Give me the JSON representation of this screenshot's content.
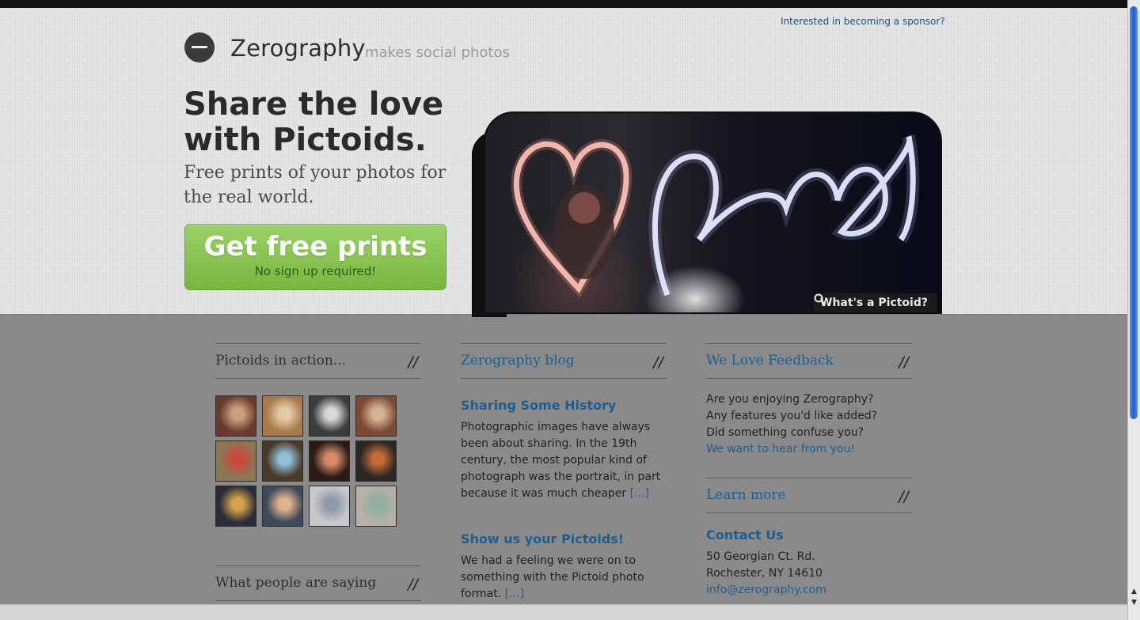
{
  "header": {
    "sponsor_link": "Interested in becoming a sponsor?",
    "brand": "Zerography",
    "tagline": "makes social photos"
  },
  "hero": {
    "headline": "Share the love with Pictoids.",
    "subheadline": "Free prints of your photos for the real world.",
    "cta_title": "Get free prints",
    "cta_subtitle": "No sign up required!",
    "photo_badge": "What's a Pictoid?"
  },
  "columns": {
    "pictoids": {
      "title": "Pictoids in action...",
      "slashes": "//",
      "thumbnails": [
        {
          "color": "#6b3a2f",
          "accent": "#c9a27a"
        },
        {
          "color": "#a8794c",
          "accent": "#e4c9a3"
        },
        {
          "color": "#3a3c3d",
          "accent": "#d8d8d8"
        },
        {
          "color": "#7a4a34",
          "accent": "#d6b391"
        },
        {
          "color": "#8b7656",
          "accent": "#c94a3a"
        },
        {
          "color": "#4a3a2a",
          "accent": "#8fc0d8"
        },
        {
          "color": "#2a1a18",
          "accent": "#d88a6a"
        },
        {
          "color": "#2c2624",
          "accent": "#c46a3a"
        },
        {
          "color": "#2b2e3a",
          "accent": "#d8a24a"
        },
        {
          "color": "#3e4a5a",
          "accent": "#e0b290"
        },
        {
          "color": "#c8c8cc",
          "accent": "#8f9aa8"
        },
        {
          "color": "#b7b0a8",
          "accent": "#8fb0a0"
        }
      ],
      "testimonials_title": "What people are saying",
      "testimonials_slashes": "//"
    },
    "blog": {
      "title": "Zerography blog",
      "slashes": "//",
      "posts": [
        {
          "title": "Sharing Some History",
          "excerpt": "Photographic images have always been about sharing. In the 19th century, the most popular kind of photograph was the portrait, in part because it was much cheaper",
          "more": "[...]"
        },
        {
          "title": "Show us your Pictoids!",
          "excerpt": "We had a feeling we were on to something with the Pictoid photo format.",
          "more": "[...]"
        }
      ]
    },
    "feedback": {
      "title": "We Love Feedback",
      "slashes": "//",
      "lines": [
        "Are you enjoying Zerography?",
        "Any features you'd like added?",
        "Did something confuse you?"
      ],
      "link": "We want to hear from you!",
      "learn_more": "Learn more",
      "learn_slashes": "//",
      "contact_title": "Contact Us",
      "address_line1": "50 Georgian Ct. Rd.",
      "address_line2": "Rochester, NY 14610",
      "email": "info@zerography.com"
    }
  },
  "colors": {
    "accent_green": "#78b63f",
    "link_blue": "#1f5d8f",
    "lower_bg": "#8a8a8a"
  }
}
